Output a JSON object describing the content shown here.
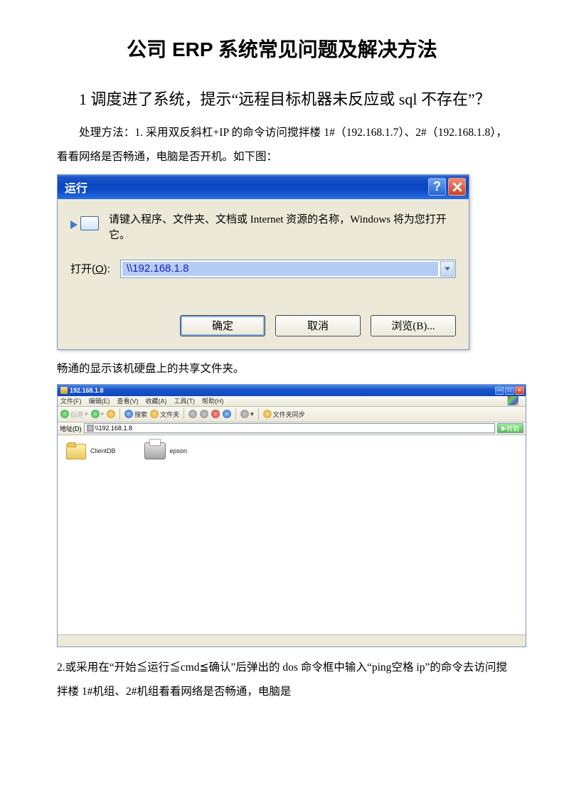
{
  "title": "公司 ERP 系统常见问题及解决方法",
  "q1": "1 调度进了系统，提示“远程目标机器未反应或 sql 不存在”？",
  "p1": "处理方法：1. 采用双反斜杠+IP 的命令访问搅拌楼 1#（192.168.1.7）、2#（192.168.1.8），看看网络是否畅通，电脑是否开机。如下图：",
  "run_dialog": {
    "title": "运行",
    "prompt": "请键入程序、文件夹、文档或 Internet 资源的名称，Windows 将为您打开它。",
    "open_label_prefix": "打开(",
    "open_label_key": "O",
    "open_label_suffix": "):",
    "value": "\\\\192.168.1.8",
    "ok": "确定",
    "cancel": "取消",
    "browse": "浏览(B)..."
  },
  "p2": "畅通的显示该机硬盘上的共享文件夹。",
  "explorer": {
    "title": "192.168.1.8",
    "menu": [
      "文件(F)",
      "编辑(E)",
      "查看(V)",
      "收藏(A)",
      "工具(T)",
      "帮助(H)"
    ],
    "toolbar": {
      "back": "后退",
      "search": "搜索",
      "folders": "文件夹",
      "sync": "文件夹同步"
    },
    "addr_label": "地址(D)",
    "addr_value": "\\\\192.168.1.8",
    "go": "转到",
    "shares": [
      "ClientDB",
      "epson"
    ]
  },
  "p3": "2.或采用在“开始≦运行≦cmd≦确认”后弹出的 dos 命令框中输入“ping空格 ip”的命令去访问搅拌楼 1#机组、2#机组看看网络是否畅通，电脑是"
}
